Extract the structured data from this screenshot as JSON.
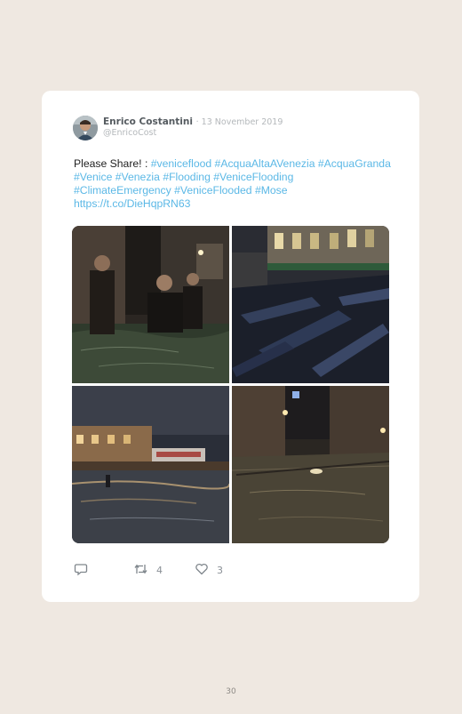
{
  "tweet": {
    "author_name": "Enrico Costantini",
    "date": "· 13 November 2019",
    "handle": "@EnricoCost",
    "text_prefix": "Please Share! : ",
    "hashtags": [
      "#veniceflood",
      "#AcquaAltaAVenezia",
      "#AcquaGranda",
      "#Venice",
      "#Venezia",
      "#Flooding",
      "#VeniceFlooding",
      "#ClimateEmergency",
      "#VeniceFlooded",
      "#Mose"
    ],
    "link": "https://t.co/DieHqpRN63",
    "photos": [
      "flooded-street-people-wading",
      "gondolas-at-night",
      "flooded-waterfront-promenade",
      "flooded-canal-night"
    ],
    "retweet_count": "4",
    "like_count": "3"
  },
  "page": {
    "number": "30"
  },
  "colors": {
    "background": "#efe8e1",
    "card": "#ffffff",
    "hashtag": "#5bb8e6",
    "icon": "#8a9096"
  }
}
